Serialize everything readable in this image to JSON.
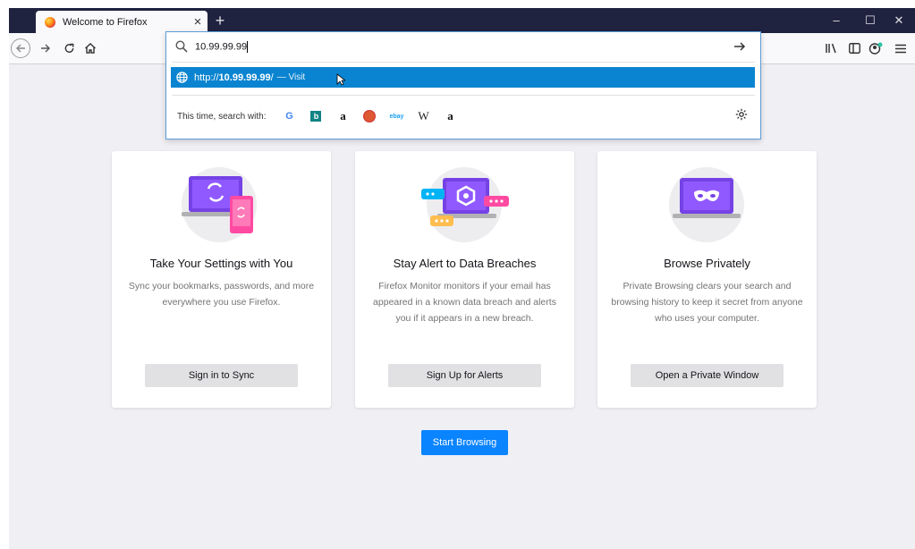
{
  "browser": {
    "tab_title": "Welcome to Firefox",
    "tab_close": "×",
    "new_tab": "+",
    "window_controls": {
      "minimize": "–",
      "maximize": "☐",
      "close": "✕"
    }
  },
  "urlbar": {
    "typed_value": "10.99.99.99",
    "suggestion": {
      "prefix": "http://",
      "host": "10.99.99.99",
      "suffix": "/",
      "action": "— Visit"
    },
    "search_with_label": "This time, search with:",
    "engines": [
      {
        "name": "google-icon",
        "glyph": "G"
      },
      {
        "name": "bing-icon",
        "glyph": "b"
      },
      {
        "name": "amazon-icon",
        "glyph": "a"
      },
      {
        "name": "duckduckgo-icon",
        "glyph": ""
      },
      {
        "name": "ebay-icon",
        "glyph": "ebay"
      },
      {
        "name": "wikipedia-icon",
        "glyph": "W"
      },
      {
        "name": "amazon-icon-2",
        "glyph": "a"
      }
    ]
  },
  "cards": [
    {
      "heading": "Take Your Settings with You",
      "body": "Sync your bookmarks, passwords, and more everywhere you use Firefox.",
      "button": "Sign in to Sync"
    },
    {
      "heading": "Stay Alert to Data Breaches",
      "body": "Firefox Monitor monitors if your email has appeared in a known data breach and alerts you if it appears in a new breach.",
      "button": "Sign Up for Alerts"
    },
    {
      "heading": "Browse Privately",
      "body": "Private Browsing clears your search and browsing history to keep it secret from anyone who uses your computer.",
      "button": "Open a Private Window"
    }
  ],
  "start_button": "Start Browsing",
  "colors": {
    "accent": "#0a84ff",
    "selection": "#0a84d0",
    "tabbar": "#202340",
    "page_bg": "#f0f0f4",
    "illustration_purple": "#7542e5",
    "illustration_pink": "#ff4aa2"
  }
}
